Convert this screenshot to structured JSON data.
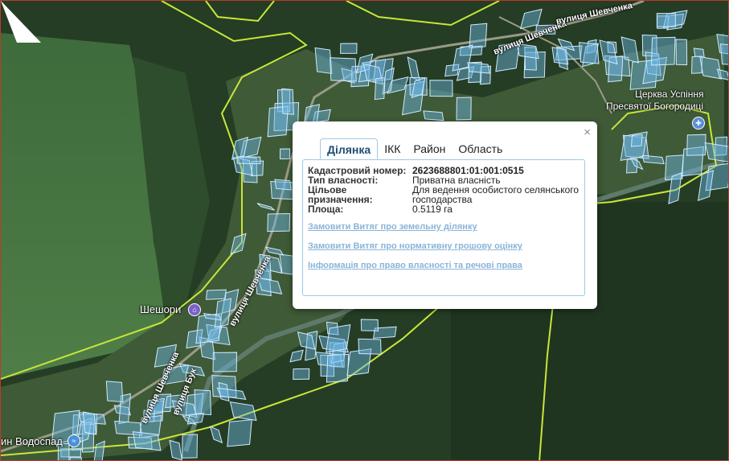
{
  "map": {
    "labels": {
      "village_shoshory": "Шешори",
      "church": "Церква Успіння",
      "church_2": "Пресвятої Богородиці",
      "street_top": "вулиця Шевченка",
      "street_top_2": "вулиця Шевченка",
      "street_mid": "вулиця Шевченка",
      "street_low": "вулиця Шевченка",
      "street_low_2": "вулиця Бук",
      "waterfall": "ин Водоспад"
    },
    "colors": {
      "parcel_fill": "#6fb8e6",
      "parcel_stroke": "#cfeaff",
      "boundary": "#c8e63a"
    },
    "icons": {
      "poi": "museum-icon",
      "church": "church-icon",
      "waterfall": "waterfall-icon"
    }
  },
  "popup": {
    "close_label": "×",
    "tabs": [
      {
        "label": "Ділянка",
        "active": true
      },
      {
        "label": "ІКК",
        "active": false
      },
      {
        "label": "Район",
        "active": false
      },
      {
        "label": "Область",
        "active": false
      }
    ],
    "info": {
      "cadastral_key": "Кадастровий номер:",
      "cadastral_val": "2623688801:01:001:0515",
      "ownership_key": "Тип власності:",
      "ownership_val": "Приватна власність",
      "purpose_key": "Цільове призначення:",
      "purpose_val": "Для ведення особистого селянського господарства",
      "area_key": "Площа:",
      "area_val": "0.5119 га"
    },
    "links": [
      "Замовити Витяг про земельну ділянку",
      "Замовити Витяг про нормативну грошову оцінку",
      "Інформація про право власності та речові права"
    ]
  }
}
